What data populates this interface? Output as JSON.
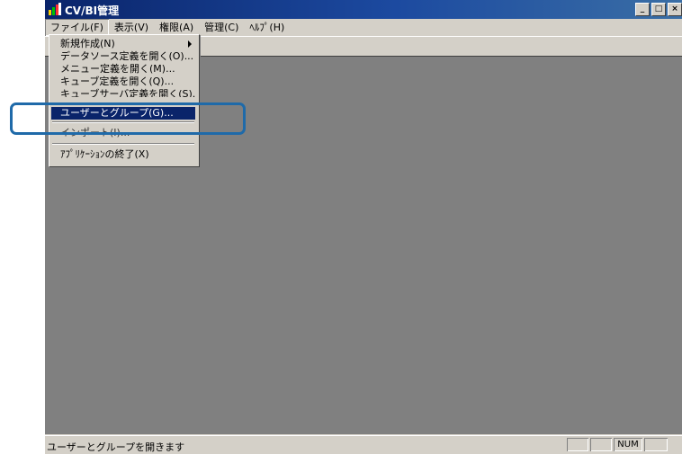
{
  "window": {
    "title": "CV/BI管理",
    "controls": {
      "minimize": "_",
      "maximize": "□",
      "close": "×"
    }
  },
  "menubar": {
    "items": [
      {
        "label": "ファイル(F)"
      },
      {
        "label": "表示(V)"
      },
      {
        "label": "権限(A)"
      },
      {
        "label": "管理(C)"
      },
      {
        "label": "ﾍﾙﾌﾟ(H)"
      }
    ]
  },
  "file_menu": {
    "items": [
      {
        "label": "新規作成(N)",
        "has_submenu": true
      },
      {
        "label": "データソース定義を開く(O)..."
      },
      {
        "label": "メニュー定義を開く(M)..."
      },
      {
        "label": "キューブ定義を開く(Q)..."
      },
      {
        "label": "キューブサーバ定義を開く(S)..."
      },
      {
        "label": "ユーザーとグループ(G)...",
        "selected": true
      },
      {
        "label": "インポート(I)..."
      },
      {
        "label": "ｱﾌﾟﾘｹｰｼｮﾝの終了(X)"
      }
    ]
  },
  "statusbar": {
    "text": "ユーザーとグループを開きます",
    "indicators": [
      "",
      "",
      "NUM",
      ""
    ]
  },
  "colors": {
    "title_bar": "#0a246a",
    "menu_selection": "#0a246a",
    "client_area": "#808080",
    "highlight_box": "#1f6aa9"
  }
}
